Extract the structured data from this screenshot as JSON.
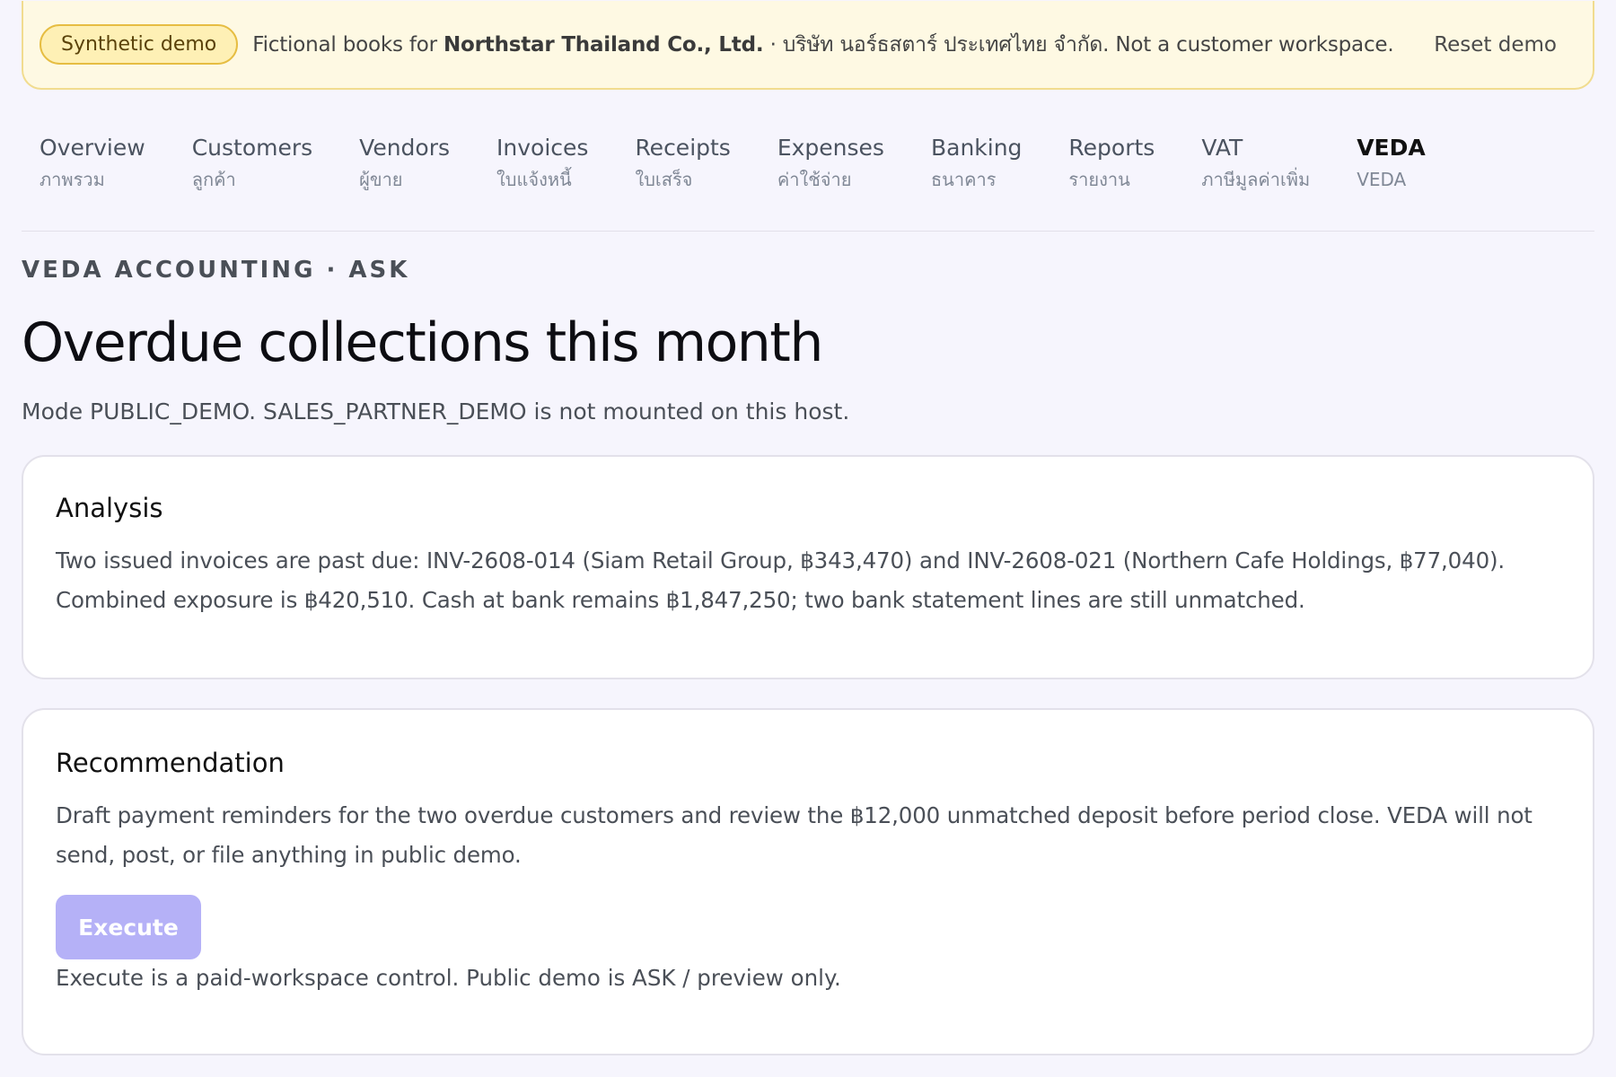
{
  "banner": {
    "badge": "Synthetic demo",
    "text_prefix": "Fictional books for ",
    "company": "Northstar Thailand Co., Ltd.",
    "text_suffix": " · บริษัท นอร์ธสตาร์ ประเทศไทย จำกัด. Not a customer workspace.",
    "reset": "Reset demo",
    "colors": {
      "background": "#fef9e3",
      "border": "#f1dc8f",
      "badge_border": "#e6bd42"
    }
  },
  "nav": {
    "items": [
      {
        "label": "Overview",
        "thai": "ภาพรวม"
      },
      {
        "label": "Customers",
        "thai": "ลูกค้า"
      },
      {
        "label": "Vendors",
        "thai": "ผู้ขาย"
      },
      {
        "label": "Invoices",
        "thai": "ใบแจ้งหนี้"
      },
      {
        "label": "Receipts",
        "thai": "ใบเสร็จ"
      },
      {
        "label": "Expenses",
        "thai": "ค่าใช้จ่าย"
      },
      {
        "label": "Banking",
        "thai": "ธนาคาร"
      },
      {
        "label": "Reports",
        "thai": "รายงาน"
      },
      {
        "label": "VAT",
        "thai": "ภาษีมูลค่าเพิ่ม"
      },
      {
        "label": "VEDA",
        "thai": "VEDA"
      }
    ],
    "active": "VEDA"
  },
  "header": {
    "eyebrow": "VEDA ACCOUNTING · ASK",
    "title": "Overdue collections this month",
    "mode": "Mode PUBLIC_DEMO. SALES_PARTNER_DEMO is not mounted on this host."
  },
  "analysis": {
    "title": "Analysis",
    "body": "Two issued invoices are past due: INV-2608-014 (Siam Retail Group, ฿343,470) and INV-2608-021 (Northern Cafe Holdings, ฿77,040). Combined exposure is ฿420,510. Cash at bank remains ฿1,847,250; two bank statement lines are still unmatched."
  },
  "recommendation": {
    "title": "Recommendation",
    "body": "Draft payment reminders for the two overdue customers and review the ฿12,000 unmatched deposit before period close. VEDA will not send, post, or file anything in public demo.",
    "execute_label": "Execute",
    "execute_note": "Execute is a paid-workspace control. Public demo is ASK / preview only.",
    "colors": {
      "execute_button": "#b5b1f7"
    }
  }
}
